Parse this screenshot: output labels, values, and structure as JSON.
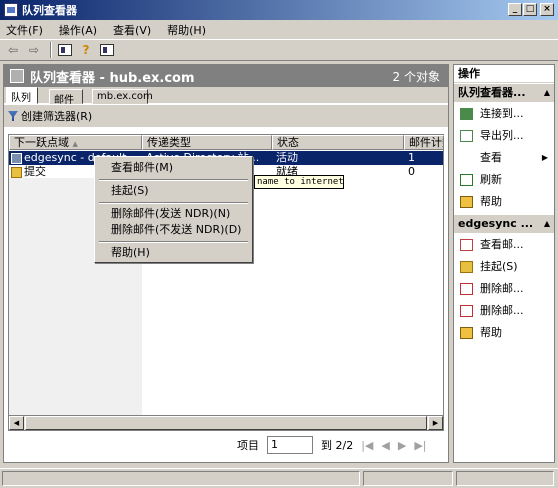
{
  "window": {
    "title": "队列查看器"
  },
  "menu": [
    "文件(F)",
    "操作(A)",
    "查看(V)",
    "帮助(H)"
  ],
  "toolbar": {
    "icons": [
      "back-icon",
      "forward-icon",
      "console-tree-icon",
      "help-icon",
      "action-pane-icon"
    ]
  },
  "left_pane": {
    "header_title": "队列查看器 - hub.ex.com",
    "object_count": "2 个对象",
    "tabs": [
      "队列",
      "邮件",
      "mb.ex.com"
    ],
    "create_filter": "创建筛选器(R)",
    "columns": [
      "下一跃点域",
      "传递类型",
      "状态",
      "邮件计数"
    ],
    "rows": [
      {
        "domain": "edgesync - default",
        "type": "Active Directory 站...",
        "status": "活动",
        "count": "1"
      },
      {
        "domain": "提交",
        "type": "",
        "status": "就绪",
        "count": "0"
      }
    ],
    "tooltip": "name to internet",
    "pager": {
      "label": "项目",
      "value": "1",
      "of": "到 2/2"
    }
  },
  "context_menu": {
    "items": [
      "查看邮件(M)",
      "挂起(S)",
      "删除邮件(发送 NDR)(N)",
      "删除邮件(不发送 NDR)(D)",
      "帮助(H)"
    ]
  },
  "right_pane": {
    "title": "操作",
    "section1": "队列查看器...",
    "section1_items": [
      "连接到...",
      "导出列...",
      "查看",
      "刷新",
      "帮助"
    ],
    "section2": "edgesync ...",
    "section2_items": [
      "查看邮...",
      "挂起(S)",
      "删除邮...",
      "删除邮...",
      "帮助"
    ]
  }
}
